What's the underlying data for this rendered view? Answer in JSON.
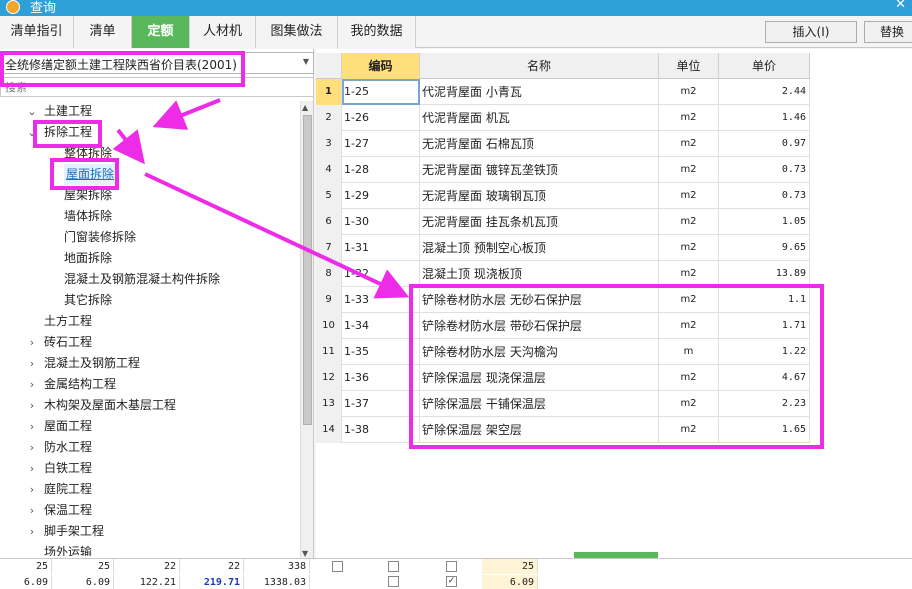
{
  "window": {
    "title": "查询"
  },
  "tabs": [
    {
      "label": "清单指引"
    },
    {
      "label": "清单"
    },
    {
      "label": "定额"
    },
    {
      "label": "人材机"
    },
    {
      "label": "图集做法"
    },
    {
      "label": "我的数据"
    }
  ],
  "toolbar": {
    "insert_label": "插入(I)",
    "replace_label": "替换"
  },
  "left": {
    "quota_book": "全统修缮定额土建工程陕西省价目表(2001)",
    "search_placeholder": "搜索",
    "tree": [
      {
        "label": "土建工程",
        "expander": "expanded"
      },
      {
        "label": "拆除工程",
        "expander": "expanded"
      },
      {
        "label": "整体拆除",
        "expander": "none"
      },
      {
        "label": "屋面拆除",
        "expander": "none",
        "selected": true
      },
      {
        "label": "屋架拆除",
        "expander": "none"
      },
      {
        "label": "墙体拆除",
        "expander": "none"
      },
      {
        "label": "门窗装修拆除",
        "expander": "none"
      },
      {
        "label": "地面拆除",
        "expander": "none"
      },
      {
        "label": "混凝土及钢筋混凝土构件拆除",
        "expander": "none"
      },
      {
        "label": "其它拆除",
        "expander": "none"
      },
      {
        "label": "土方工程",
        "expander": "none"
      },
      {
        "label": "砖石工程",
        "expander": "collapsed"
      },
      {
        "label": "混凝土及钢筋工程",
        "expander": "collapsed"
      },
      {
        "label": "金属结构工程",
        "expander": "collapsed"
      },
      {
        "label": "木构架及屋面木基层工程",
        "expander": "collapsed"
      },
      {
        "label": "屋面工程",
        "expander": "collapsed"
      },
      {
        "label": "防水工程",
        "expander": "collapsed"
      },
      {
        "label": "白铁工程",
        "expander": "collapsed"
      },
      {
        "label": "庭院工程",
        "expander": "collapsed"
      },
      {
        "label": "保温工程",
        "expander": "collapsed"
      },
      {
        "label": "脚手架工程",
        "expander": "collapsed"
      },
      {
        "label": "场外运输",
        "expander": "none"
      }
    ]
  },
  "grid": {
    "headers": {
      "code": "编码",
      "name": "名称",
      "unit": "单位",
      "price": "单价"
    },
    "rows": [
      {
        "idx": "1",
        "code": "1-25",
        "name": "代泥背屋面 小青瓦",
        "unit": "m2",
        "price": "2.44"
      },
      {
        "idx": "2",
        "code": "1-26",
        "name": "代泥背屋面 机瓦",
        "unit": "m2",
        "price": "1.46"
      },
      {
        "idx": "3",
        "code": "1-27",
        "name": "无泥背屋面 石棉瓦顶",
        "unit": "m2",
        "price": "0.97"
      },
      {
        "idx": "4",
        "code": "1-28",
        "name": "无泥背屋面 镀锌瓦垄铁顶",
        "unit": "m2",
        "price": "0.73"
      },
      {
        "idx": "5",
        "code": "1-29",
        "name": "无泥背屋面 玻璃钢瓦顶",
        "unit": "m2",
        "price": "0.73"
      },
      {
        "idx": "6",
        "code": "1-30",
        "name": "无泥背屋面 挂瓦条机瓦顶",
        "unit": "m2",
        "price": "1.05"
      },
      {
        "idx": "7",
        "code": "1-31",
        "name": "混凝土顶 预制空心板顶",
        "unit": "m2",
        "price": "9.65"
      },
      {
        "idx": "8",
        "code": "1-32",
        "name": "混凝土顶 现浇板顶",
        "unit": "m2",
        "price": "13.89"
      },
      {
        "idx": "9",
        "code": "1-33",
        "name": "铲除卷材防水层 无砂石保护层",
        "unit": "m2",
        "price": "1.1"
      },
      {
        "idx": "10",
        "code": "1-34",
        "name": "铲除卷材防水层 带砂石保护层",
        "unit": "m2",
        "price": "1.71"
      },
      {
        "idx": "11",
        "code": "1-35",
        "name": "铲除卷材防水层 天沟檐沟",
        "unit": "m",
        "price": "1.22"
      },
      {
        "idx": "12",
        "code": "1-36",
        "name": "铲除保温层 现浇保温层",
        "unit": "m2",
        "price": "4.67"
      },
      {
        "idx": "13",
        "code": "1-37",
        "name": "铲除保温层 干铺保温层",
        "unit": "m2",
        "price": "2.23"
      },
      {
        "idx": "14",
        "code": "1-38",
        "name": "铲除保温层 架空层",
        "unit": "m2",
        "price": "1.65"
      }
    ]
  },
  "bottom": {
    "row1": [
      "25",
      "25",
      "22",
      "22",
      "338",
      "25"
    ],
    "row2": [
      "6.09",
      "6.09",
      "122.21",
      "219.71",
      "1338.03",
      "6.09"
    ]
  },
  "colors": {
    "accent_green": "#5bb75b",
    "annotation_magenta": "#ee2ce8",
    "header_yellow": "#ffdf7a"
  }
}
